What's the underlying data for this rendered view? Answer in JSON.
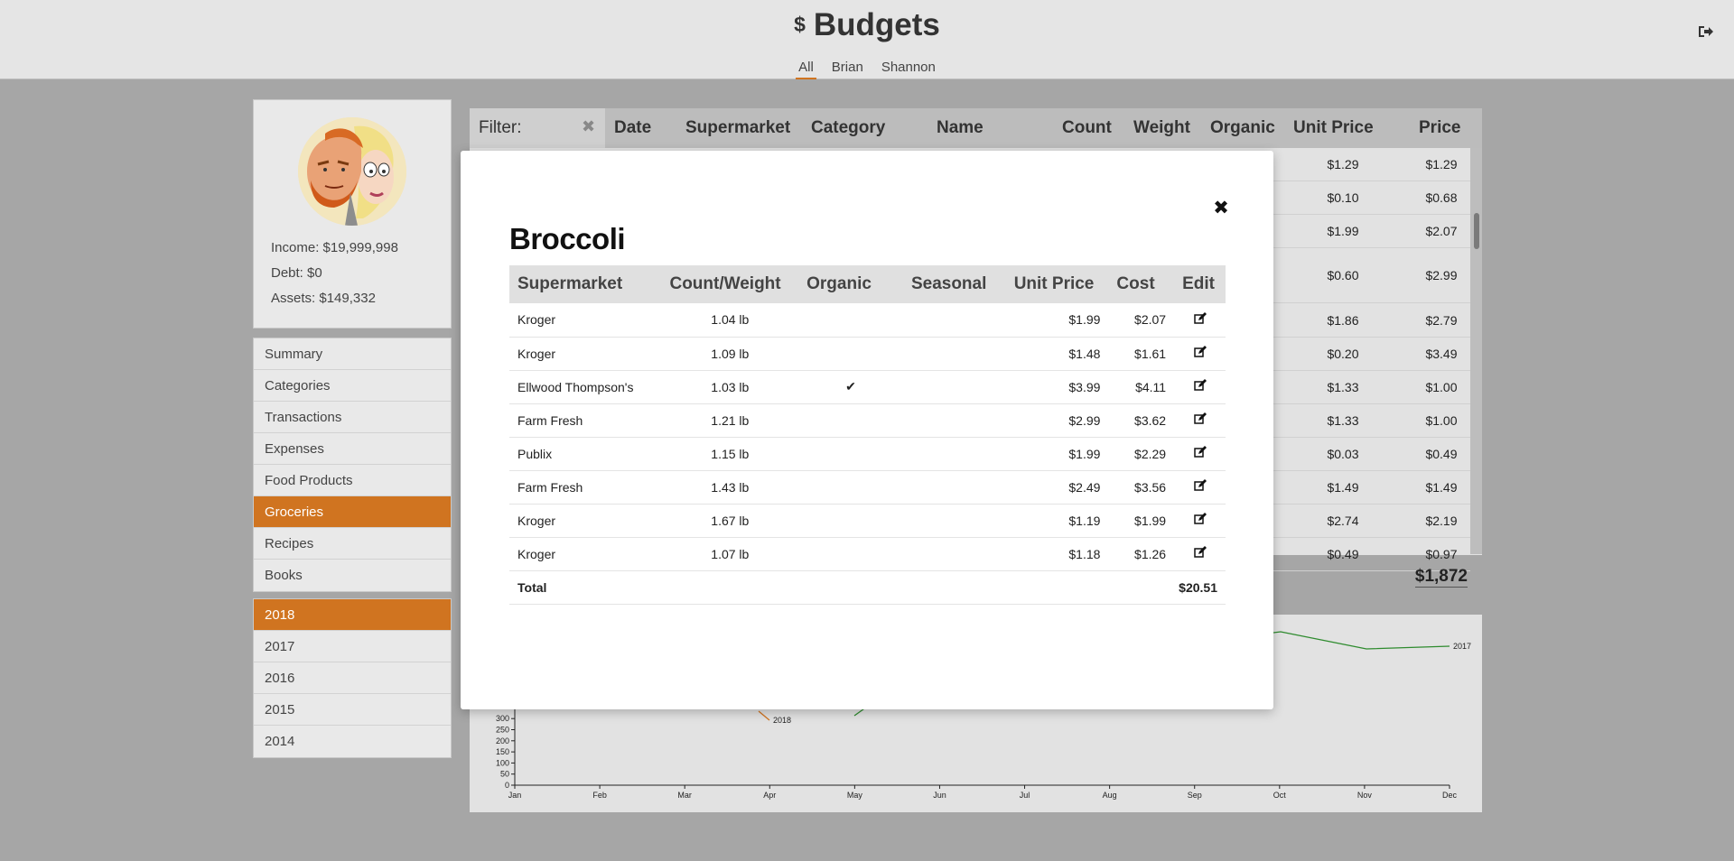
{
  "header": {
    "dollar": "$",
    "title": "Budgets",
    "tabs": [
      "All",
      "Brian",
      "Shannon"
    ],
    "active_tab": "All",
    "logout_icon": "sign-out-icon"
  },
  "profile": {
    "income": "Income: $19,999,998",
    "debt": "Debt: $0",
    "assets": "Assets: $149,332"
  },
  "nav": {
    "items": [
      "Summary",
      "Categories",
      "Transactions",
      "Expenses",
      "Food Products",
      "Groceries",
      "Recipes",
      "Books"
    ],
    "active": "Groceries"
  },
  "years": {
    "items": [
      "2018",
      "2017",
      "2016",
      "2015",
      "2014"
    ],
    "active": "2018"
  },
  "groceries": {
    "filter_label": "Filter:",
    "columns": [
      "Date",
      "Supermarket",
      "Category",
      "Name",
      "Count",
      "Weight",
      "Organic",
      "Unit Price",
      "Price"
    ],
    "rows": [
      {
        "unit": "$1.29",
        "price": "$1.29"
      },
      {
        "unit": "$0.10",
        "price": "$0.68"
      },
      {
        "unit": "$1.99",
        "price": "$2.07"
      },
      {
        "unit": "$0.60",
        "price": "$2.99"
      },
      {
        "unit": "$1.86",
        "price": "$2.79"
      },
      {
        "unit": "$0.20",
        "price": "$3.49"
      },
      {
        "unit": "$1.33",
        "price": "$1.00"
      },
      {
        "unit": "$1.33",
        "price": "$1.00"
      },
      {
        "unit": "$0.03",
        "price": "$0.49"
      },
      {
        "unit": "$1.49",
        "price": "$1.49"
      },
      {
        "unit": "$2.74",
        "price": "$2.19"
      },
      {
        "unit": "$0.49",
        "price": "$0.97"
      }
    ],
    "total": "$1,872"
  },
  "chart_data": {
    "type": "line",
    "x": [
      "Jan",
      "Feb",
      "Mar",
      "Apr",
      "May",
      "Jun",
      "Jul",
      "Aug",
      "Sep",
      "Oct",
      "Nov",
      "Dec"
    ],
    "y_ticks": [
      "0",
      "50",
      "100",
      "150",
      "200",
      "250",
      "300"
    ],
    "series": [
      {
        "name": "2018",
        "color": "#d07420"
      },
      {
        "name": "2017",
        "color": "#2e8b2e"
      }
    ]
  },
  "modal": {
    "title": "Broccoli",
    "close_icon": "close-icon",
    "columns": [
      "Supermarket",
      "Count/Weight",
      "Organic",
      "Seasonal",
      "Unit Price",
      "Cost",
      "Edit"
    ],
    "rows": [
      {
        "supermarket": "Kroger",
        "weight": "1.04 lb",
        "organic": false,
        "unit_price": "$1.99",
        "cost": "$2.07"
      },
      {
        "supermarket": "Kroger",
        "weight": "1.09 lb",
        "organic": false,
        "unit_price": "$1.48",
        "cost": "$1.61"
      },
      {
        "supermarket": "Ellwood Thompson's",
        "weight": "1.03 lb",
        "organic": true,
        "unit_price": "$3.99",
        "cost": "$4.11"
      },
      {
        "supermarket": "Farm Fresh",
        "weight": "1.21 lb",
        "organic": false,
        "unit_price": "$2.99",
        "cost": "$3.62"
      },
      {
        "supermarket": "Publix",
        "weight": "1.15 lb",
        "organic": false,
        "unit_price": "$1.99",
        "cost": "$2.29"
      },
      {
        "supermarket": "Farm Fresh",
        "weight": "1.43 lb",
        "organic": false,
        "unit_price": "$2.49",
        "cost": "$3.56"
      },
      {
        "supermarket": "Kroger",
        "weight": "1.67 lb",
        "organic": false,
        "unit_price": "$1.19",
        "cost": "$1.99"
      },
      {
        "supermarket": "Kroger",
        "weight": "1.07 lb",
        "organic": false,
        "unit_price": "$1.18",
        "cost": "$1.26"
      }
    ],
    "total_label": "Total",
    "total_value": "$20.51"
  }
}
